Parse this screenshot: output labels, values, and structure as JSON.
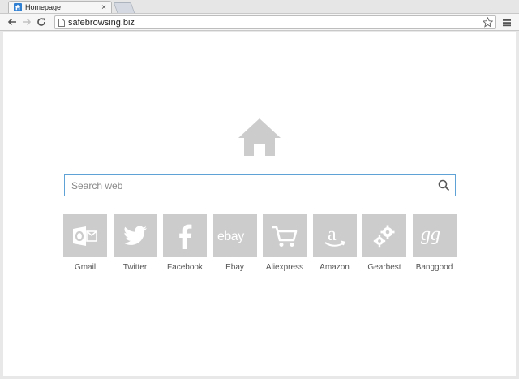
{
  "browser": {
    "tab": {
      "title": "Homepage",
      "close": "×"
    },
    "address": "safebrowsing.biz"
  },
  "page": {
    "search_placeholder": "Search web",
    "tiles": [
      {
        "label": "Gmail",
        "icon": "outlook-icon"
      },
      {
        "label": "Twitter",
        "icon": "twitter-icon"
      },
      {
        "label": "Facebook",
        "icon": "facebook-icon"
      },
      {
        "label": "Ebay",
        "icon": "ebay-icon"
      },
      {
        "label": "Aliexpress",
        "icon": "cart-icon"
      },
      {
        "label": "Amazon",
        "icon": "amazon-icon"
      },
      {
        "label": "Gearbest",
        "icon": "gears-icon"
      },
      {
        "label": "Banggood",
        "icon": "banggood-icon"
      }
    ],
    "colors": {
      "tile": "#cccccc",
      "logo": "#cccccc",
      "search_border": "#5ea2d6"
    }
  }
}
